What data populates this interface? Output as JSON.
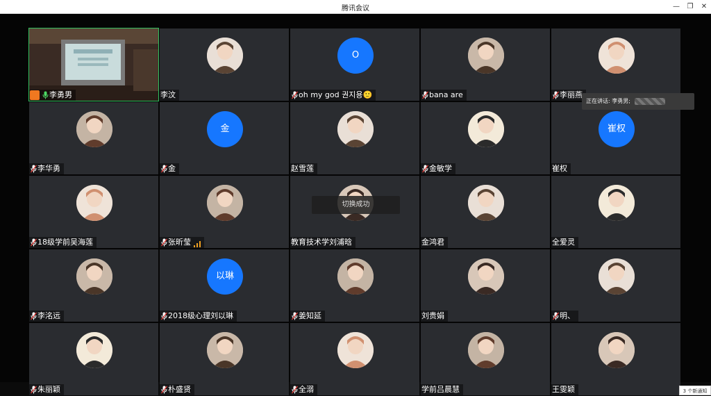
{
  "window": {
    "title": "腾讯会议",
    "minimize_icon": "minimize-icon",
    "restore_icon": "restore-icon",
    "close_icon": "close-icon"
  },
  "participants": [
    {
      "name": "李勇男",
      "avatar_text": "",
      "mic": "on",
      "host": true,
      "video": true
    },
    {
      "name": "李汶",
      "avatar_text": "",
      "mic": "none"
    },
    {
      "name": "oh my god 권지용🙂",
      "avatar_text": "O",
      "mic": "muted"
    },
    {
      "name": "bana are",
      "avatar_text": "",
      "mic": "muted"
    },
    {
      "name": "李丽燕",
      "avatar_text": "",
      "mic": "muted"
    },
    {
      "name": "李华勇",
      "avatar_text": "",
      "mic": "muted"
    },
    {
      "name": "金",
      "avatar_text": "金",
      "mic": "muted"
    },
    {
      "name": "赵雪莲",
      "avatar_text": "",
      "mic": "none"
    },
    {
      "name": "金敏学",
      "avatar_text": "",
      "mic": "muted"
    },
    {
      "name": "崔权",
      "avatar_text": "崔权",
      "mic": "none"
    },
    {
      "name": "18级学前吴海莲",
      "avatar_text": "",
      "mic": "muted"
    },
    {
      "name": "张昕莹",
      "avatar_text": "",
      "mic": "muted",
      "signal": true
    },
    {
      "name": "教育技术学刘浦晗",
      "avatar_text": "",
      "mic": "none"
    },
    {
      "name": "金鸿君",
      "avatar_text": "",
      "mic": "none"
    },
    {
      "name": "全爱灵",
      "avatar_text": "",
      "mic": "none"
    },
    {
      "name": "李洺远",
      "avatar_text": "",
      "mic": "muted"
    },
    {
      "name": "2018级心理刘以琳",
      "avatar_text": "以琳",
      "mic": "muted"
    },
    {
      "name": "姜知延",
      "avatar_text": "",
      "mic": "muted"
    },
    {
      "name": "刘贵娟",
      "avatar_text": "",
      "mic": "none"
    },
    {
      "name": "明、",
      "avatar_text": "",
      "mic": "muted"
    },
    {
      "name": "朱丽颖",
      "avatar_text": "",
      "mic": "muted"
    },
    {
      "name": "朴盛贤",
      "avatar_text": "",
      "mic": "muted"
    },
    {
      "name": "全溺",
      "avatar_text": "",
      "mic": "muted"
    },
    {
      "name": "学前吕晨慧",
      "avatar_text": "",
      "mic": "none"
    },
    {
      "name": "王雯颖",
      "avatar_text": "",
      "mic": "none"
    }
  ],
  "toast": "切换成功",
  "speaking": {
    "label": "正在讲话: 李勇男;"
  },
  "notification": "3 个新通知",
  "colors": {
    "accent": "#1677ff",
    "tile_bg": "#2a2c30",
    "active_border": "#30c060",
    "host_badge": "#f07820"
  }
}
